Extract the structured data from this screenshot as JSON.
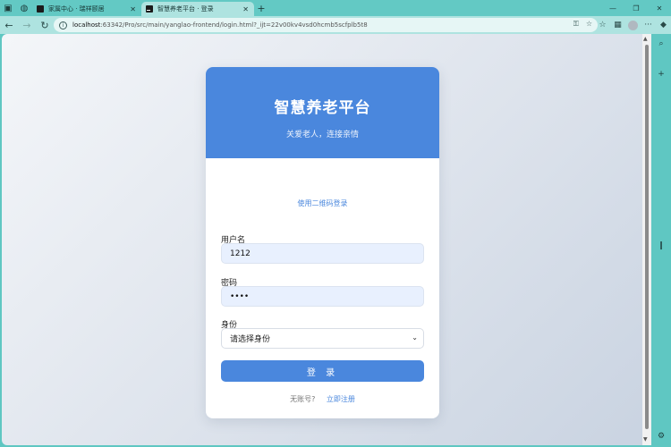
{
  "tabs": [
    {
      "label": "家属中心 · 瑞祥颐居",
      "active": false
    },
    {
      "label": "智慧养老平台 · 登录",
      "active": true
    }
  ],
  "address": {
    "host": "localhost",
    "rest": ":63342/Pro/src/main/yanglao-frontend/login.html?_ijt=22v00kv4vsd0hcmb5scfplb5t8"
  },
  "card": {
    "title": "智慧养老平台",
    "subtitle": "关爱老人，连接亲情",
    "qr_link": "使用二维码登录",
    "username_label": "用户名",
    "username_value": "1212",
    "password_label": "密码",
    "password_value": "••••",
    "role_label": "身份",
    "role_placeholder": "请选择身份",
    "login_label": "登 录",
    "no_account": "无账号?",
    "register_link": "立即注册"
  },
  "colors": {
    "accent": "#4a87dd",
    "input_fill": "#e8f0fe",
    "browser_chrome": "#63c9c4"
  }
}
